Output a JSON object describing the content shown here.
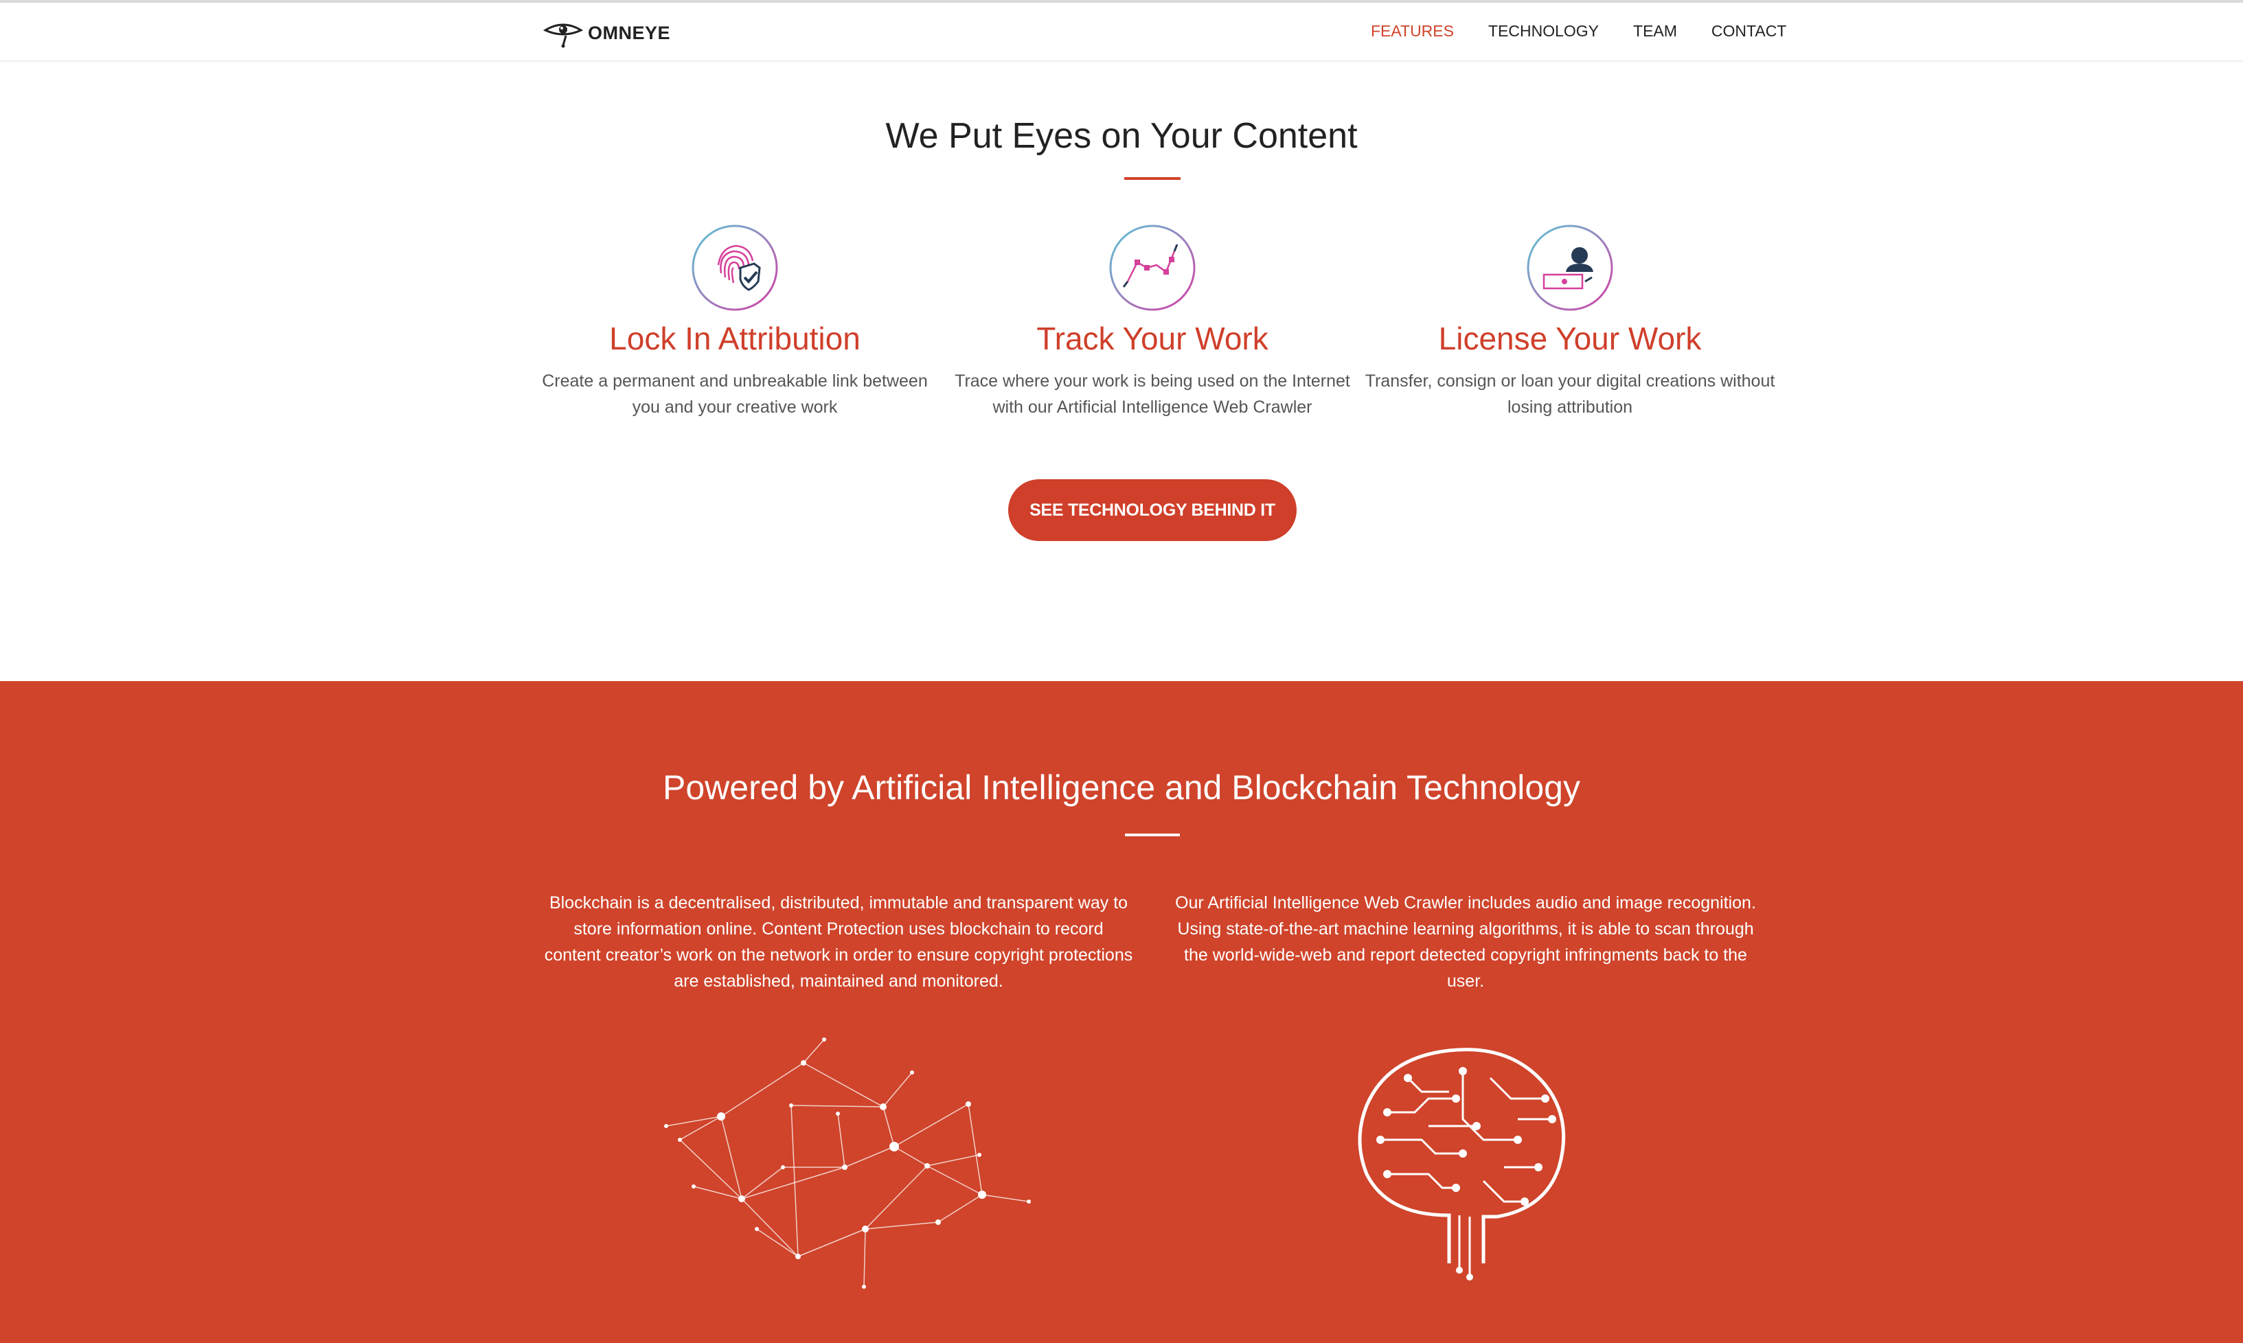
{
  "brand": {
    "name": "OMNEYE",
    "logo_icon": "eye-logo-icon"
  },
  "nav": {
    "items": [
      {
        "label": "FEATURES",
        "active": true
      },
      {
        "label": "TECHNOLOGY",
        "active": false
      },
      {
        "label": "TEAM",
        "active": false
      },
      {
        "label": "CONTACT",
        "active": false
      }
    ]
  },
  "hero": {
    "title": "We Put Eyes on Your Content",
    "features": [
      {
        "icon": "fingerprint-shield-icon",
        "title": "Lock In Attribution",
        "text": "Create a permanent and unbreakable link between you and your creative work"
      },
      {
        "icon": "trend-line-icon",
        "title": "Track Your Work",
        "text": "Trace where your work is being used on the Internet with our Artificial Intelligence Web Crawler"
      },
      {
        "icon": "person-license-icon",
        "title": "License Your Work",
        "text": "Transfer, consign or loan your digital creations without losing attribution"
      }
    ],
    "cta_label": "SEE TECHNOLOGY BEHIND IT"
  },
  "technology": {
    "title": "Powered by Artificial Intelligence and Blockchain Technology",
    "columns": [
      {
        "text": "Blockchain is a decentralised, distributed, immutable and transparent way to store information online. Content Protection uses blockchain to record content creator’s work on the network in order to ensure copyright protections are established, maintained and monitored.",
        "icon": "network-graph-icon"
      },
      {
        "text": "Our Artificial Intelligence Web Crawler includes audio and image recognition. Using state-of-the-art machine learning algorithms, it is able to scan through the world-wide-web and report detected copyright infringments back to the user.",
        "icon": "circuit-brain-icon"
      }
    ]
  },
  "colors": {
    "accent": "#cf3f2a",
    "section_bg": "#cf442b",
    "text_dark": "#222222",
    "text_muted": "#555555"
  }
}
